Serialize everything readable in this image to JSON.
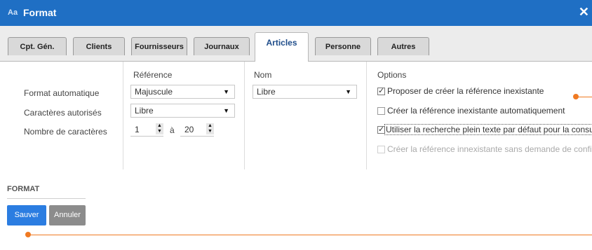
{
  "window": {
    "title": "Format",
    "logo_text": "Aa",
    "close_glyph": "✕"
  },
  "tabs": [
    {
      "label": "Cpt. Gén.",
      "active": false
    },
    {
      "label": "Clients",
      "active": false
    },
    {
      "label": "Fournisseurs",
      "active": false
    },
    {
      "label": "Journaux",
      "active": false
    },
    {
      "label": "Articles",
      "active": true
    },
    {
      "label": "Personne",
      "active": false
    },
    {
      "label": "Autres",
      "active": false
    }
  ],
  "labels": {
    "format_automatique": "Format automatique",
    "caracteres_autorises": "Caractères autorisés",
    "nombre_caracteres": "Nombre de caractères"
  },
  "reference": {
    "header": "Référence",
    "format_value": "Majuscule",
    "chars_value": "Libre",
    "min_value": "1",
    "range_sep": "à",
    "max_value": "20"
  },
  "nom": {
    "header": "Nom",
    "format_value": "Libre"
  },
  "options": {
    "header": "Options",
    "items": [
      {
        "label": "Proposer de créer la référence inexistante",
        "checked": true,
        "disabled": false
      },
      {
        "label": "Créer la référence inexistante automatiquement",
        "checked": false,
        "disabled": false
      },
      {
        "label": "Utiliser la recherche plein texte par défaut pour la consultation",
        "checked": true,
        "disabled": false
      },
      {
        "label": "Créer la référence innexistante sans demande de confirmation",
        "checked": false,
        "disabled": true
      }
    ]
  },
  "footer": {
    "section_title": "FORMAT",
    "save_label": "Sauver",
    "cancel_label": "Annuler"
  },
  "colors": {
    "title_bar": "#1f6fc4",
    "accent_orange": "#f07a22",
    "save_button": "#2b7de1",
    "cancel_button": "#8c8c8c"
  }
}
